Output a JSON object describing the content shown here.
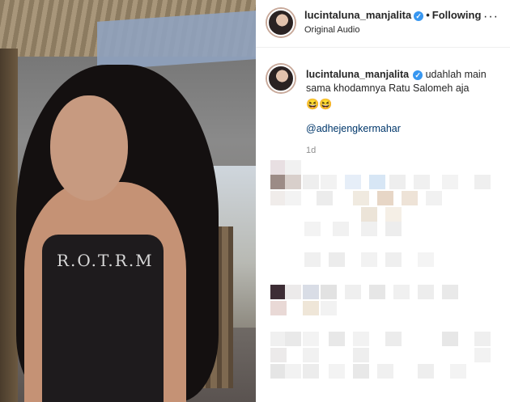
{
  "post": {
    "username": "lucintaluna_manjalita",
    "verified_glyph": "✓",
    "separator": "•",
    "follow_label": "Following",
    "audio": "Original Audio",
    "more_glyph": "···",
    "caption_text": "udahlah main sama khodamnya Ratu Salomeh aja",
    "caption_emoji": "😆😆",
    "mention": "@adhejengkermahar",
    "time": "1d"
  },
  "media": {
    "shirt_print": "R.O.T.R.M"
  },
  "icons": {
    "verified": "verified-badge-icon",
    "more": "more-options-icon"
  },
  "colors": {
    "accent": "#3897f0",
    "link": "#00376b",
    "muted": "#8e8e8e"
  }
}
